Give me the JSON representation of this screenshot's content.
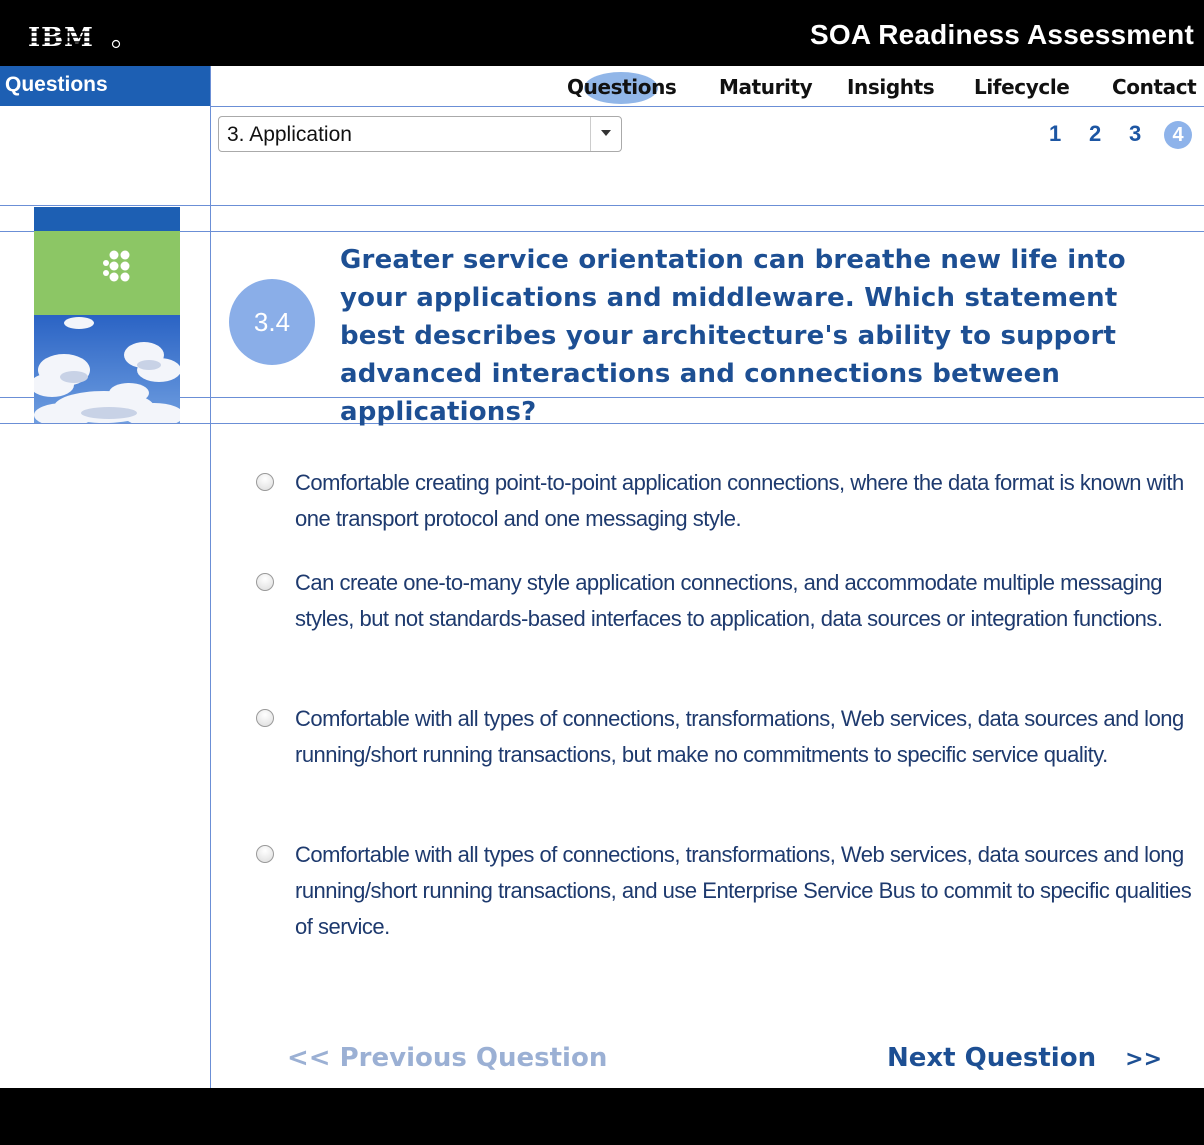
{
  "header": {
    "brand": "IBM",
    "title": "SOA Readiness Assessment"
  },
  "sidebar": {
    "tab_label": "Questions"
  },
  "nav": {
    "items": [
      "Questions",
      "Maturity",
      "Insights",
      "Lifecycle",
      "Contact"
    ],
    "active": "Questions"
  },
  "section_select": {
    "value": "3. Application"
  },
  "pagination": {
    "pages": [
      "1",
      "2",
      "3",
      "4"
    ],
    "current": "4"
  },
  "question": {
    "number": "3.4",
    "text": "Greater service orientation can breathe new life into your applications and middleware. Which statement best describes your architecture's ability to support advanced interactions and connections between applications?"
  },
  "options": [
    "Comfortable creating point-to-point application connections, where the data format is known with one transport protocol and one messaging style.",
    "Can create one-to-many style application connections, and accommodate multiple messaging styles, but not standards-based interfaces to application, data sources or integration functions.",
    "Comfortable with all types of connections, transformations, Web services, data sources and long running/short running transactions, but make no commitments to specific service quality.",
    "Comfortable with all types of connections, transformations, Web services, data sources and long running/short running transactions, and use Enterprise Service Bus to commit to specific qualities of service."
  ],
  "footer_nav": {
    "prev_label": "<< Previous Question",
    "next_label": "Next Question",
    "next_arrow": ">>"
  },
  "colors": {
    "brand_blue": "#1d5fb3",
    "question_blue": "#1d4f93",
    "badge_blue": "#8aaee8",
    "green_tile": "#8cc665"
  }
}
